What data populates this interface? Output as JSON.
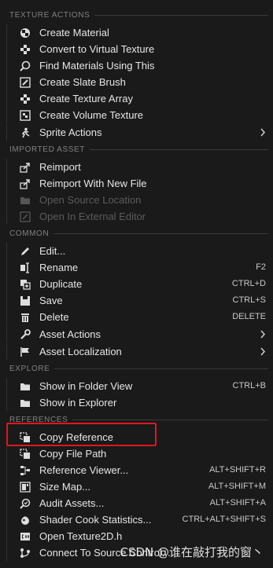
{
  "sections": {
    "texture_actions": "TEXTURE ACTIONS",
    "imported_asset": "IMPORTED ASSET",
    "common": "COMMON",
    "explore": "EXPLORE",
    "references": "REFERENCES"
  },
  "items": {
    "create_material": {
      "label": "Create Material",
      "icon": "material-sphere-icon"
    },
    "convert_virtual": {
      "label": "Convert to Virtual Texture",
      "icon": "checker-icon"
    },
    "find_materials": {
      "label": "Find Materials Using This",
      "icon": "search-icon"
    },
    "create_slate_brush": {
      "label": "Create Slate Brush",
      "icon": "brush-icon"
    },
    "create_texture_array": {
      "label": "Create Texture Array",
      "icon": "checker-icon"
    },
    "create_volume_texture": {
      "label": "Create Volume Texture",
      "icon": "volume-icon"
    },
    "sprite_actions": {
      "label": "Sprite Actions",
      "icon": "sprite-icon"
    },
    "reimport": {
      "label": "Reimport",
      "icon": "reimport-icon"
    },
    "reimport_new_file": {
      "label": "Reimport With New File",
      "icon": "reimport-icon"
    },
    "open_source_location": {
      "label": "Open Source Location",
      "icon": "folder-icon",
      "disabled": true
    },
    "open_external_editor": {
      "label": "Open In External Editor",
      "icon": "external-icon",
      "disabled": true
    },
    "edit": {
      "label": "Edit...",
      "icon": "pencil-icon"
    },
    "rename": {
      "label": "Rename",
      "shortcut": "F2",
      "icon": "rename-icon"
    },
    "duplicate": {
      "label": "Duplicate",
      "shortcut": "CTRL+D",
      "icon": "duplicate-icon"
    },
    "save": {
      "label": "Save",
      "shortcut": "CTRL+S",
      "icon": "save-icon"
    },
    "delete": {
      "label": "Delete",
      "shortcut": "DELETE",
      "icon": "trash-icon"
    },
    "asset_actions": {
      "label": "Asset Actions",
      "icon": "wrench-icon"
    },
    "asset_localization": {
      "label": "Asset Localization",
      "icon": "flag-icon"
    },
    "show_folder_view": {
      "label": "Show in Folder View",
      "shortcut": "CTRL+B",
      "icon": "folder-view-icon"
    },
    "show_explorer": {
      "label": "Show in Explorer",
      "icon": "folder-icon"
    },
    "copy_reference": {
      "label": "Copy Reference",
      "icon": "copy-icon"
    },
    "copy_file_path": {
      "label": "Copy File Path",
      "icon": "copy-icon"
    },
    "reference_viewer": {
      "label": "Reference Viewer...",
      "shortcut": "ALT+SHIFT+R",
      "icon": "graph-icon"
    },
    "size_map": {
      "label": "Size Map...",
      "shortcut": "ALT+SHIFT+M",
      "icon": "sizemap-icon"
    },
    "audit_assets": {
      "label": "Audit Assets...",
      "shortcut": "ALT+SHIFT+A",
      "icon": "audit-icon"
    },
    "shader_cook": {
      "label": "Shader Cook Statistics...",
      "shortcut": "CTRL+ALT+SHIFT+S",
      "icon": "shader-icon"
    },
    "open_header": {
      "label": "Open Texture2D.h",
      "icon": "cpp-file-icon"
    },
    "connect_source_control": {
      "label": "Connect To Source Control...",
      "icon": "source-control-icon"
    }
  },
  "watermark": "CSDN @谁在敲打我的窗丶",
  "colors": {
    "background": "#1a1a1a",
    "highlight_border": "#e0161d",
    "disabled_text": "#5a5a5a"
  }
}
